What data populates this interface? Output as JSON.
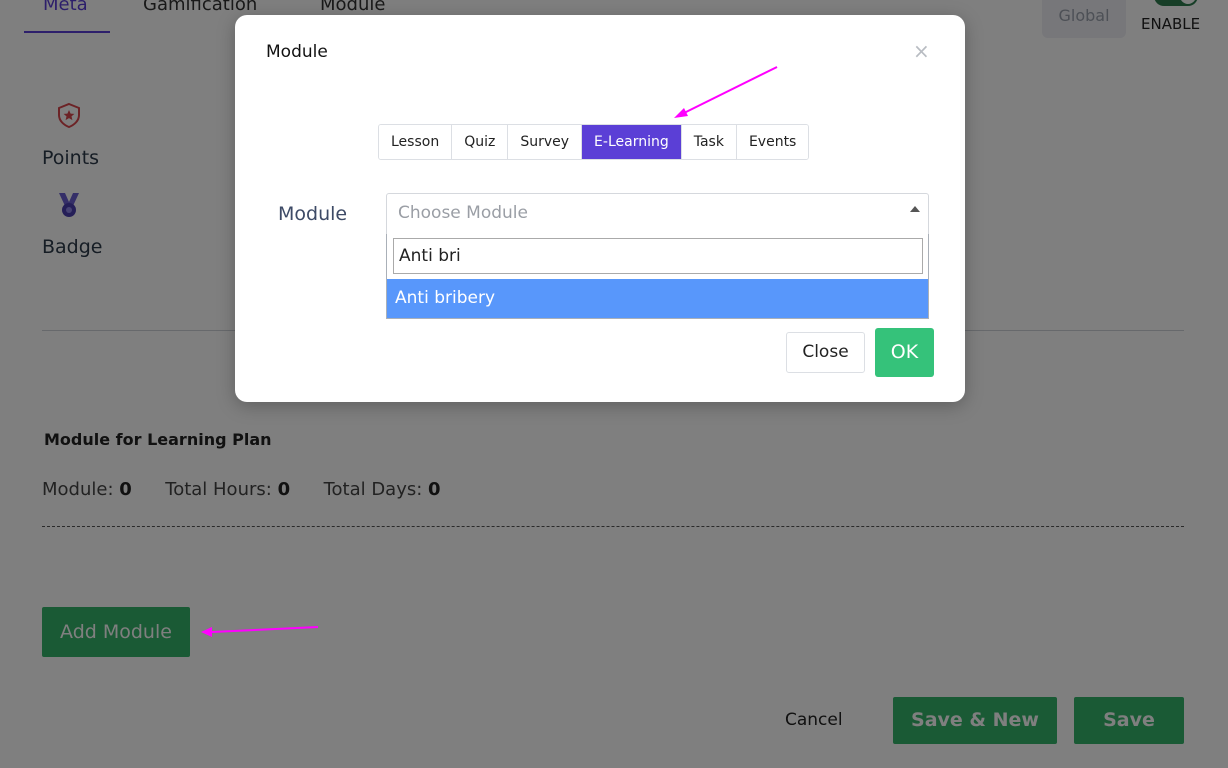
{
  "page": {
    "tabs": [
      {
        "label": "Meta"
      },
      {
        "label": "Gamification"
      },
      {
        "label": "Module"
      }
    ],
    "global_label": "Global",
    "enable_label": "ENABLE",
    "points_label": "Points",
    "badge_label": "Badge",
    "plan_title": "Module for Learning Plan",
    "stats": {
      "module_label": "Module:",
      "module_value": "0",
      "hours_label": "Total Hours:",
      "hours_value": "0",
      "days_label": "Total Days:",
      "days_value": "0"
    },
    "add_module_label": "Add Module",
    "cancel_label": "Cancel",
    "save_new_label": "Save & New",
    "save_label": "Save"
  },
  "modal": {
    "title": "Module",
    "close_icon": "×",
    "type_tabs": [
      {
        "label": "Lesson"
      },
      {
        "label": "Quiz"
      },
      {
        "label": "Survey"
      },
      {
        "label": "E-Learning"
      },
      {
        "label": "Task"
      },
      {
        "label": "Events"
      }
    ],
    "active_type_tab": "E-Learning",
    "field_label": "Module",
    "select_placeholder": "Choose Module",
    "search_value": "Anti bri",
    "options": [
      {
        "label": "Anti bribery"
      }
    ],
    "close_button": "Close",
    "ok_button": "OK"
  },
  "colors": {
    "accent": "#5b3fd6",
    "green": "#35b56a",
    "highlight": "#5897fb",
    "annotation_arrow": "#ff00ff"
  },
  "icons": {
    "points": "shield-star-icon",
    "badge": "badge-ribbon-icon"
  }
}
